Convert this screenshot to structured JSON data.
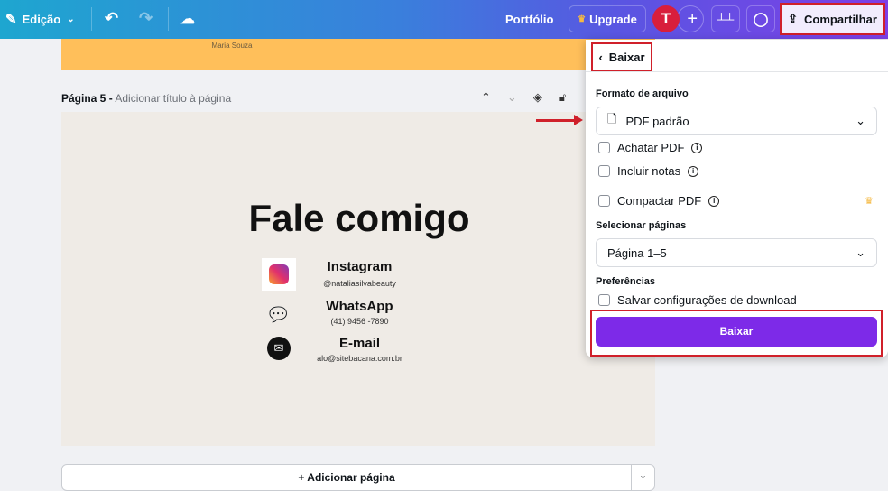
{
  "topbar": {
    "edit_label": "Edição",
    "portfolio": "Portfólio",
    "upgrade": "Upgrade",
    "avatar_initial": "T",
    "share": "Compartilhar"
  },
  "canvas": {
    "prev_page_text": "Maria Souza",
    "page_label": "Página 5 -",
    "page_title_placeholder": "Adicionar título à página",
    "heading": "Fale comigo",
    "contacts": [
      {
        "title": "Instagram",
        "value": "@nataliasilvabeauty"
      },
      {
        "title": "WhatsApp",
        "value": "(41) 9456 -7890"
      },
      {
        "title": "E-mail",
        "value": "alo@sitebacana.com.br"
      }
    ],
    "add_page": "+ Adicionar página"
  },
  "panel": {
    "back_label": "Baixar",
    "format_label": "Formato de arquivo",
    "format_value": "PDF padrão",
    "options": [
      "Achatar PDF",
      "Incluir notas",
      "Compactar PDF"
    ],
    "pages_label": "Selecionar páginas",
    "pages_value": "Página 1–5",
    "prefs_label": "Preferências",
    "save_settings": "Salvar configurações de download",
    "download_button": "Baixar"
  },
  "colors": {
    "accent": "#7d2ae8",
    "highlight": "#d0202a",
    "page_bg": "#efebe6",
    "prev_page": "#ffbf5a"
  }
}
